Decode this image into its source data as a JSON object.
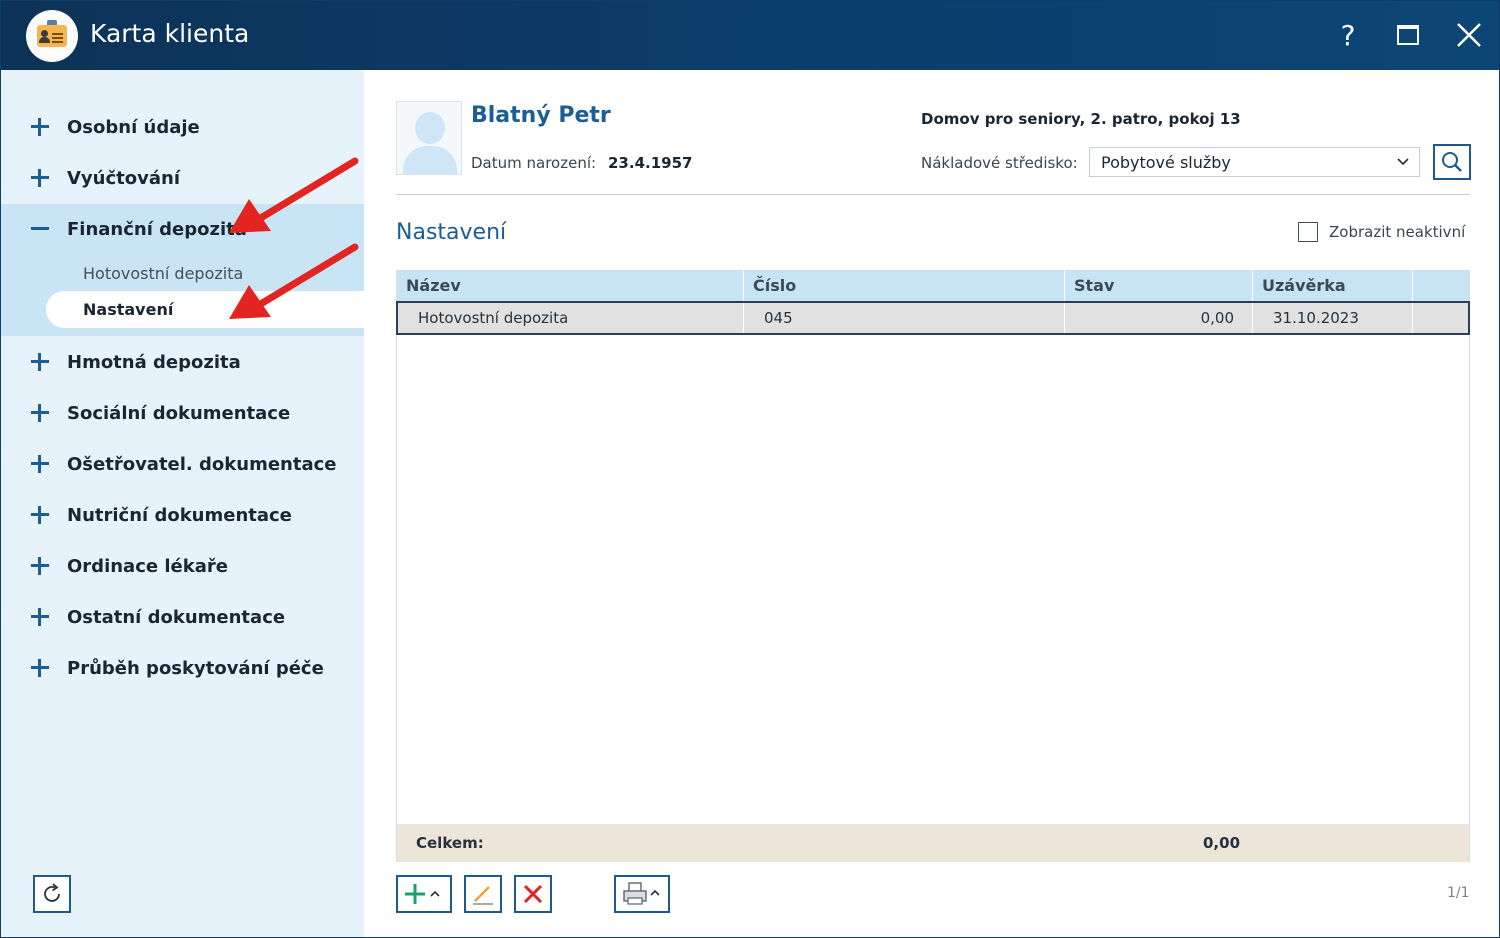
{
  "window": {
    "title": "Karta klienta",
    "help_glyph": "?",
    "close_glyph": "✕"
  },
  "sidebar": {
    "items": [
      {
        "label": "Osobní údaje",
        "state": "collapsed"
      },
      {
        "label": "Vyúčtování",
        "state": "collapsed"
      },
      {
        "label": "Finanční depozita",
        "state": "expanded"
      },
      {
        "label": "Hmotná depozita",
        "state": "collapsed"
      },
      {
        "label": "Sociální dokumentace",
        "state": "collapsed"
      },
      {
        "label": "Ošetřovatel. dokumentace",
        "state": "collapsed"
      },
      {
        "label": "Nutriční dokumentace",
        "state": "collapsed"
      },
      {
        "label": "Ordinace lékaře",
        "state": "collapsed"
      },
      {
        "label": "Ostatní dokumentace",
        "state": "collapsed"
      },
      {
        "label": "Průběh poskytování péče",
        "state": "collapsed"
      }
    ],
    "subitems": [
      {
        "label": "Hotovostní depozita",
        "selected": false
      },
      {
        "label": "Nastavení",
        "selected": true
      }
    ]
  },
  "client": {
    "name": "Blatný Petr",
    "dob_label": "Datum narození:",
    "dob_value": "23.4.1957",
    "location": "Domov pro seniory, 2. patro, pokoj 13",
    "cost_center_label": "Nákladové středisko:",
    "cost_center_value": "Pobytové služby"
  },
  "section": {
    "title": "Nastavení",
    "show_inactive_label": "Zobrazit neaktivní",
    "show_inactive_checked": false
  },
  "table": {
    "columns": [
      "Název",
      "Číslo",
      "Stav",
      "Uzávěrka"
    ],
    "rows": [
      [
        "Hotovostní depozita",
        "045",
        "0,00",
        "31.10.2023"
      ]
    ],
    "footer_label": "Celkem:",
    "footer_total": "0,00"
  },
  "pager": "1/1",
  "colors": {
    "titlebar": "#0b3f6e",
    "accent": "#1b5e96",
    "sidebar_bg": "#e6f3fb",
    "arrow": "#e32420"
  },
  "icons": [
    "app-icon",
    "help-icon",
    "maximize-icon",
    "close-icon",
    "plus-icon",
    "minus-icon",
    "refresh-icon",
    "search-icon",
    "chevron-down-icon",
    "add-icon",
    "edit-icon",
    "delete-icon",
    "print-icon"
  ]
}
